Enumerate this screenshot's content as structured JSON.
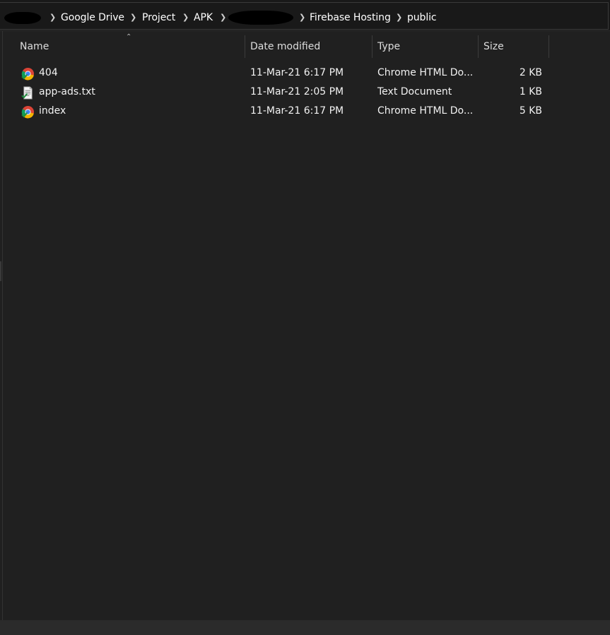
{
  "breadcrumb": {
    "items": [
      {
        "label": "Google Drive"
      },
      {
        "label": "Project"
      },
      {
        "label": "APK"
      },
      {
        "label": "Firebase Hosting"
      },
      {
        "label": "public"
      }
    ]
  },
  "columns": {
    "name": "Name",
    "date_modified": "Date modified",
    "type": "Type",
    "size": "Size"
  },
  "files": [
    {
      "name": "404",
      "date": "11-Mar-21 6:17 PM",
      "type": "Chrome HTML Do...",
      "size": "2 KB",
      "icon": "chrome-html-icon"
    },
    {
      "name": "app-ads.txt",
      "date": "11-Mar-21 2:05 PM",
      "type": "Text Document",
      "size": "1 KB",
      "icon": "text-document-icon"
    },
    {
      "name": "index",
      "date": "11-Mar-21 6:17 PM",
      "type": "Chrome HTML Do...",
      "size": "5 KB",
      "icon": "chrome-html-icon"
    }
  ],
  "colors": {
    "background": "#202020",
    "address_bar": "#191919",
    "text": "#ffffff"
  }
}
